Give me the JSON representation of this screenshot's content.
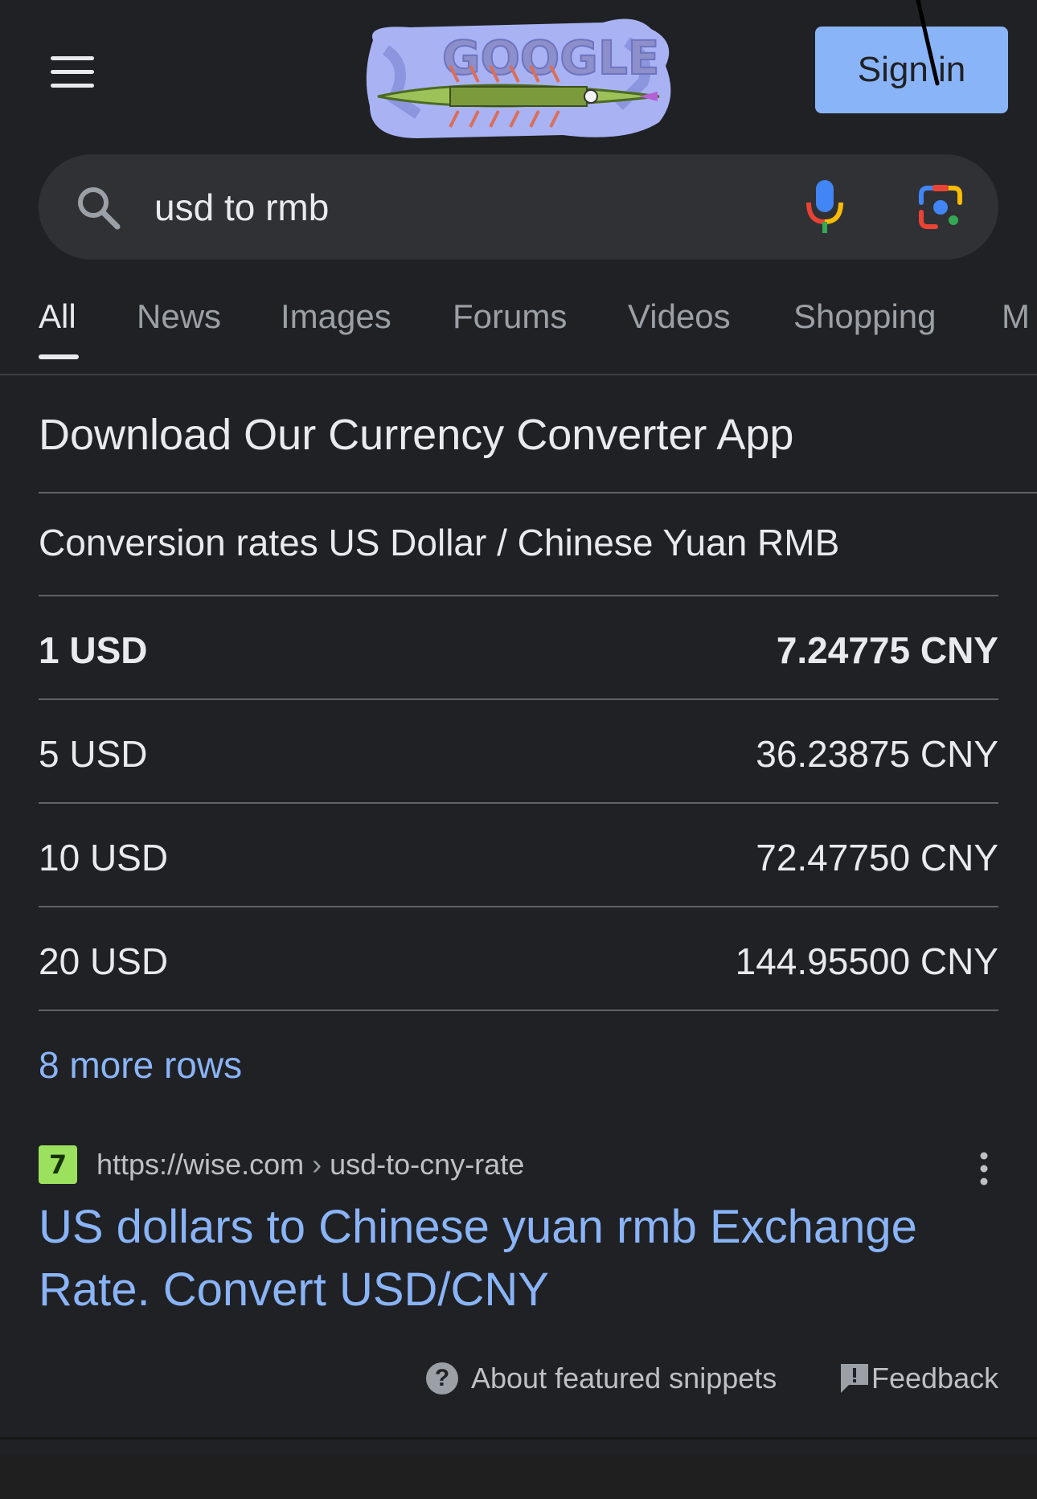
{
  "header": {
    "sign_in_label": "Sign in",
    "doodle_text": "GOOGLE"
  },
  "search": {
    "query": "usd to rmb"
  },
  "tabs": [
    {
      "label": "All",
      "active": true
    },
    {
      "label": "News"
    },
    {
      "label": "Images"
    },
    {
      "label": "Forums"
    },
    {
      "label": "Videos"
    },
    {
      "label": "Shopping"
    },
    {
      "label": "M"
    }
  ],
  "snippet": {
    "heading": "Download Our Currency Converter App",
    "table_caption": "Conversion rates US Dollar / Chinese Yuan RMB",
    "rows": [
      {
        "usd": "1 USD",
        "cny": "7.24775 CNY"
      },
      {
        "usd": "5 USD",
        "cny": "36.23875 CNY"
      },
      {
        "usd": "10 USD",
        "cny": "72.47750 CNY"
      },
      {
        "usd": "20 USD",
        "cny": "144.95500 CNY"
      }
    ],
    "more_rows": "8 more rows"
  },
  "source": {
    "favicon_glyph": "7",
    "url_domain": "https://wise.com",
    "url_separator": "›",
    "url_path": "usd-to-cny-rate",
    "title": "US dollars to Chinese yuan rmb Exchange Rate. Convert USD/CNY"
  },
  "footer": {
    "about_icon_glyph": "?",
    "about_label": "About featured snippets",
    "feedback_label": "Feedback"
  },
  "colors": {
    "background": "#202124",
    "link": "#8ab4f8",
    "text": "#e8eaed",
    "muted": "#9aa0a6",
    "sign_in_button": "#8ab4f8",
    "favicon": "#9be15d"
  },
  "icons": [
    "hamburger-menu-icon",
    "search-icon",
    "mic-icon",
    "google-lens-icon",
    "more-options-icon",
    "help-icon",
    "feedback-icon"
  ]
}
